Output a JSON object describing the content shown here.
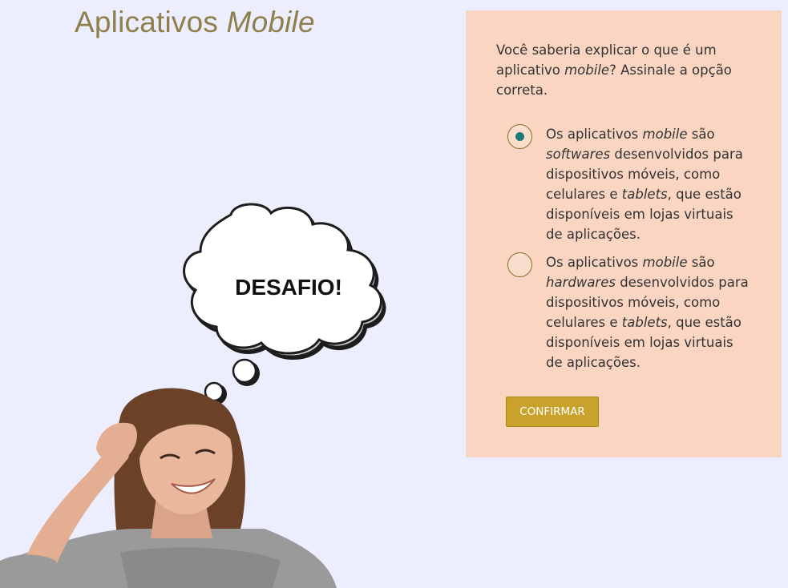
{
  "page": {
    "title_plain": "Aplicativos ",
    "title_italic": "Mobile",
    "background": "#ecedfd"
  },
  "illustration": {
    "bubble_text": "DESAFIO!",
    "subject": "smiling woman scratching her head",
    "icon": "thought-bubble-icon"
  },
  "quiz": {
    "panel_color": "#f9d5c2",
    "question": {
      "p1": "Você saberia explicar o que é um aplicativo ",
      "italic1": "mobile",
      "p2": "? Assinale a opção correta."
    },
    "options": [
      {
        "selected": true,
        "t1": "Os aplicativos ",
        "i1": "mobile",
        "t2": " são ",
        "i2": "softwares",
        "t3": " desenvolvidos para dispositivos móveis, como celulares e ",
        "i3": "tablets",
        "t4": ", que estão disponíveis em lojas virtuais de aplicações."
      },
      {
        "selected": false,
        "t1": "Os aplicativos ",
        "i1": "mobile",
        "t2": " são ",
        "i2": "hardwares",
        "t3": " desenvolvidos para dispositivos móveis, como celulares e ",
        "i3": "tablets",
        "t4": ", que estão disponíveis em lojas virtuais de aplicações."
      }
    ],
    "confirm_label": "CONFIRMAR",
    "accent_color": "#c9a22c",
    "radio_dot_color": "#1c7a76"
  }
}
